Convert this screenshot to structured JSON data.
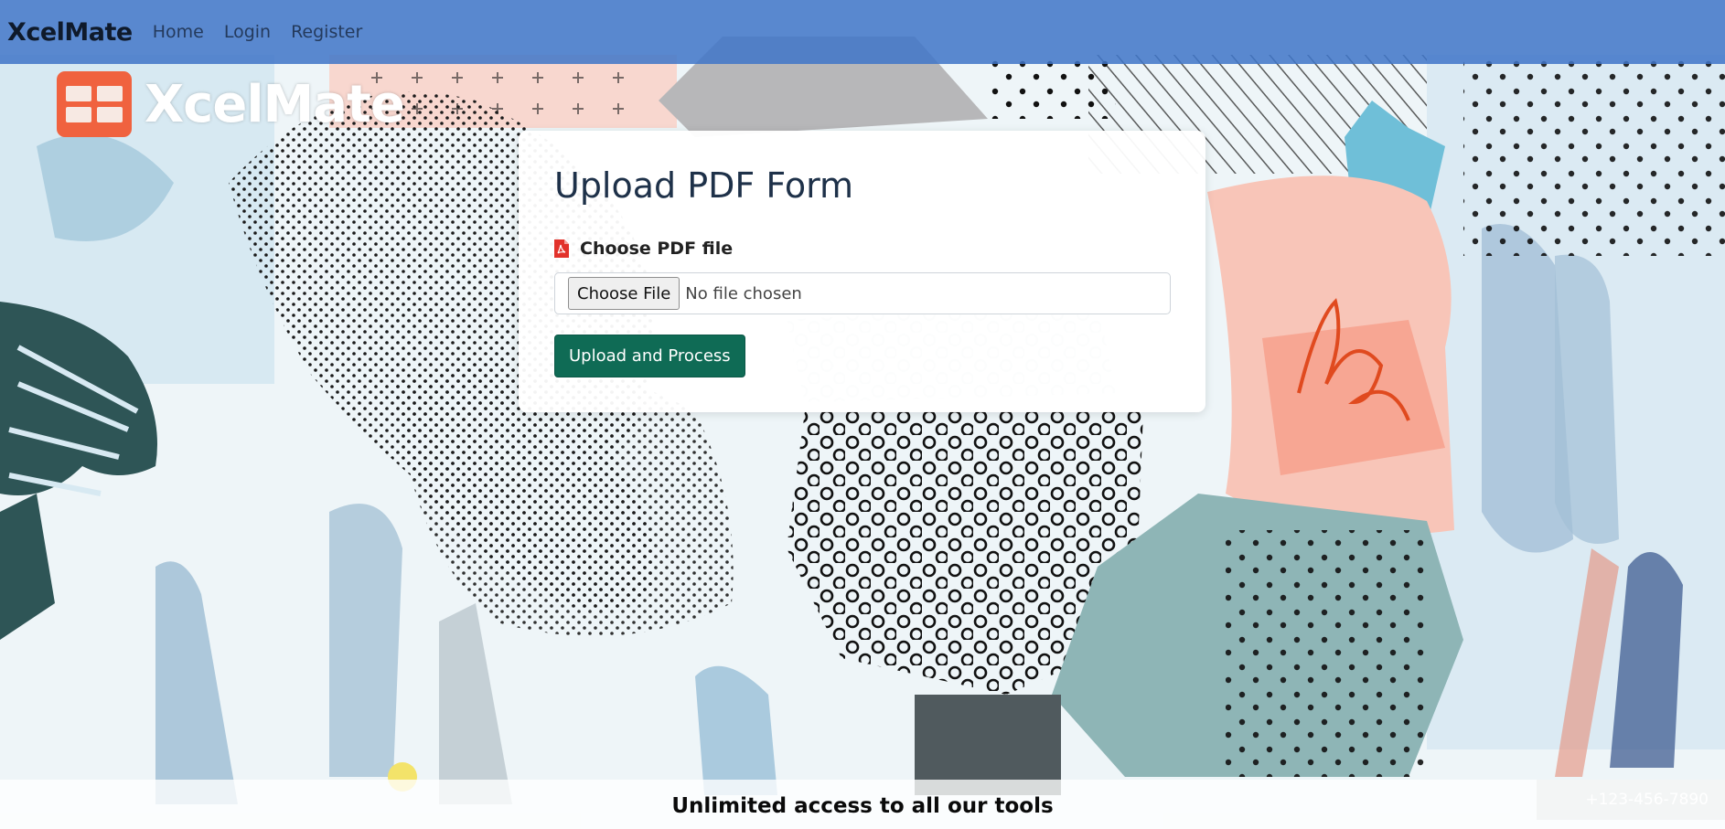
{
  "navbar": {
    "brand": "XcelMate",
    "links": [
      "Home",
      "Login",
      "Register"
    ]
  },
  "logo": {
    "text": "XcelMate",
    "icon": "spreadsheet-grid-icon",
    "color": "#f0623f"
  },
  "form": {
    "title": "Upload PDF Form",
    "file_label": "Choose PDF file",
    "file_icon": "pdf-file-icon",
    "choose_button": "Choose File",
    "file_status": "No file chosen",
    "submit_button": "Upload and Process"
  },
  "footer": {
    "tagline": "Unlimited access to all our tools",
    "phone": "+123-456-7890"
  },
  "colors": {
    "navbar": "#4076c8",
    "primary_button": "#0f6b55",
    "pdf_icon": "#e2322b"
  }
}
